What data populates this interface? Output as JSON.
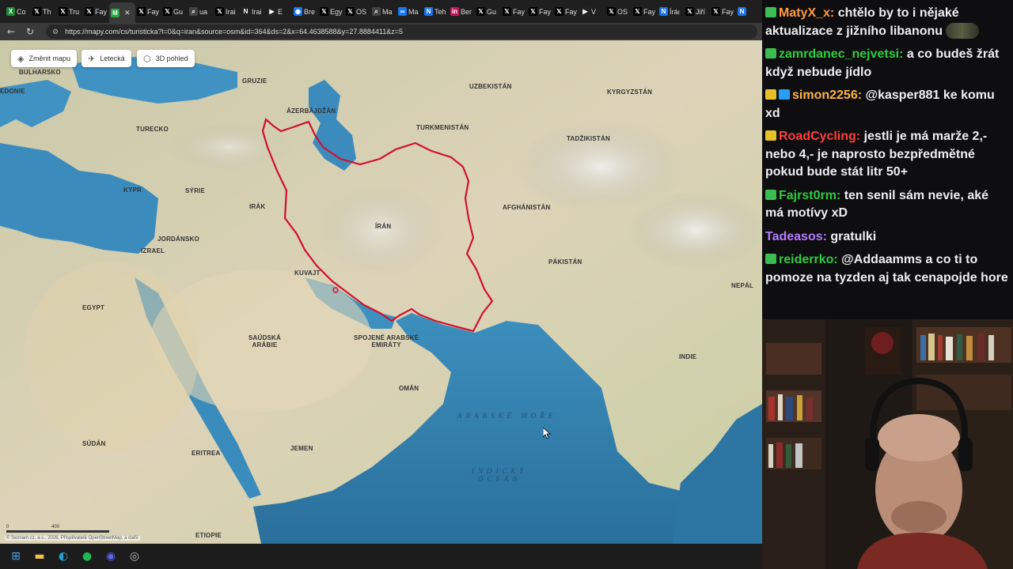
{
  "tabs": [
    {
      "label": "Co",
      "icon": "green-x-icon",
      "color": "#1f8a3a"
    },
    {
      "label": "Th",
      "icon": "x-icon",
      "color": "#000"
    },
    {
      "label": "Tru",
      "icon": "x-icon",
      "color": "#000"
    },
    {
      "label": "Fay",
      "icon": "x-icon",
      "color": "#000"
    },
    {
      "label": "",
      "icon": "mapy-icon",
      "color": "#2aa844",
      "active": true
    },
    {
      "label": "Fay",
      "icon": "x-icon",
      "color": "#000"
    },
    {
      "label": "Gu",
      "icon": "x-icon",
      "color": "#000"
    },
    {
      "label": "ua",
      "icon": "search-icon",
      "color": "#444"
    },
    {
      "label": "Irai",
      "icon": "x-icon",
      "color": "#000"
    },
    {
      "label": "Irai",
      "icon": "n-icon",
      "color": "#222"
    },
    {
      "label": "E",
      "icon": "video-icon",
      "color": "#222"
    },
    {
      "label": "Bre",
      "icon": "globe-icon",
      "color": "#1a73e8"
    },
    {
      "label": "Egy",
      "icon": "x-icon",
      "color": "#000"
    },
    {
      "label": "OS",
      "icon": "x-icon",
      "color": "#000"
    },
    {
      "label": "Ma",
      "icon": "search-icon",
      "color": "#444"
    },
    {
      "label": "Ma",
      "icon": "meta-icon",
      "color": "#1877f2"
    },
    {
      "label": "Teh",
      "icon": "n-icon",
      "color": "#1a73e8"
    },
    {
      "label": "Ber",
      "icon": "in-icon",
      "color": "#c2185b"
    },
    {
      "label": "Gu",
      "icon": "x-icon",
      "color": "#000"
    },
    {
      "label": "Fay",
      "icon": "x-icon",
      "color": "#000"
    },
    {
      "label": "Fay",
      "icon": "x-icon",
      "color": "#000"
    },
    {
      "label": "Fay",
      "icon": "x-icon",
      "color": "#000"
    },
    {
      "label": "V",
      "icon": "video-icon",
      "color": "#222"
    },
    {
      "label": "OS",
      "icon": "x-icon",
      "color": "#000"
    },
    {
      "label": "Fay",
      "icon": "x-icon",
      "color": "#000"
    },
    {
      "label": "Íráı",
      "icon": "n-icon",
      "color": "#1a73e8"
    },
    {
      "label": "Jiří",
      "icon": "x-icon",
      "color": "#000"
    },
    {
      "label": "Fay",
      "icon": "x-icon",
      "color": "#000"
    },
    {
      "label": "",
      "icon": "n-icon",
      "color": "#1a73e8"
    }
  ],
  "url": "https://mapy.com/cs/turisticka?l=0&q=iran&source=osm&id=364&ds=2&x=64.4638588&y=27.8884411&z=5",
  "map_controls": {
    "change_map": "Změnit mapu",
    "aerial": "Letecká",
    "view3d": "3D pohled"
  },
  "map_labels": {
    "bulharsko": "BULHARSKO",
    "gruzie": "GRUZIE",
    "azerbajdzan": "ÁZERBÁJDŽÁN",
    "turecko": "TURECKO",
    "kypr": "KYPR",
    "syrie": "SÝRIE",
    "irak": "IRÁK",
    "iran": "ÍRÁN",
    "jordansko": "JORDÁNSKO",
    "izrael": "IZRAEL",
    "kuvajt": "KUVAJT",
    "egypt": "EGYPT",
    "saudska": "SAÚDSKÁ\nARÁBIE",
    "spojene": "SPOJENÉ ARABSKÉ\nEMIRÁTY",
    "oman": "OMÁN",
    "jemen": "JEMEN",
    "sudan": "SÚDÁN",
    "eritrea": "ERITREA",
    "etiopie": "ETIOPIE",
    "uzbekistan": "UZBEKISTÁN",
    "turkmenistan": "TURKMENISTÁN",
    "kyrgyzstan": "KYRGYZSTÁN",
    "tadzikistan": "TADŽIKISTÁN",
    "afghanistan": "AFGHÁNISTÁN",
    "pakistan": "PÁKISTÁN",
    "indie": "INDIE",
    "nepal": "NEPÁL",
    "edonie": "EDONIE"
  },
  "sea_labels": {
    "arabske_more": "ARABSKÉ MOŘE",
    "indicky_ocean": "INDICKÝ\nOCEÁN"
  },
  "scale": {
    "left": "0",
    "right": "400"
  },
  "copyright": "© Seznam.cz, a.s., 2026, Přispěvatelé OpenStreetMap, a další",
  "chat": [
    {
      "user": "MatyX_x",
      "color": "#ff9a3c",
      "badge": "#3bbd52",
      "text": "chtělo by to i nějaké aktualizace z jižního libanonu",
      "emote": true
    },
    {
      "user": "zamrdanec_nejvetsi",
      "color": "#2ecc40",
      "badge": "#3bbd52",
      "text": "a co budeš žrát když nebude jídlo"
    },
    {
      "user": "simon2256",
      "color": "#ffb347",
      "badge": "#e6c02a",
      "badge2": "#2a9df4",
      "text": "@kasper881 ke komu xd"
    },
    {
      "user": "RoadCycling",
      "color": "#ff3d3d",
      "badge": "#e6c02a",
      "text": "jestli je má marže 2,- nebo 4,- je naprosto bezpředmětné pokud bude stát litr 50+"
    },
    {
      "user": "Fajrst0rm",
      "color": "#2ecc40",
      "badge": "#3bbd52",
      "text": "ten senil sám nevie, aké má motívy xD"
    },
    {
      "user": "Tadeasos",
      "color": "#b57bff",
      "text": "gratulki"
    },
    {
      "user": "reiderrko",
      "color": "#2ecc40",
      "badge": "#3bbd52",
      "text": "@Addaamms a co ti to pomoze na tyzden aj tak cenapojde hore"
    }
  ],
  "taskbar": [
    {
      "icon": "windows-icon",
      "color": "#4aa3f0"
    },
    {
      "icon": "folder-icon",
      "color": "#f2c14e"
    },
    {
      "icon": "edge-icon",
      "color": "#1fa3d4"
    },
    {
      "icon": "spotify-icon",
      "color": "#1db954"
    },
    {
      "icon": "discord-icon",
      "color": "#5865f2"
    },
    {
      "icon": "obs-icon",
      "color": "#bbbbbb"
    }
  ]
}
